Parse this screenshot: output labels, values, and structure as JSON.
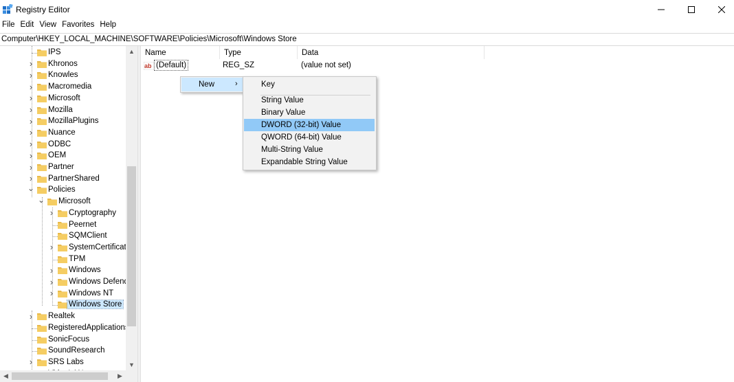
{
  "window": {
    "title": "Registry Editor"
  },
  "menu": [
    "File",
    "Edit",
    "View",
    "Favorites",
    "Help"
  ],
  "address": "Computer\\HKEY_LOCAL_MACHINE\\SOFTWARE\\Policies\\Microsoft\\Windows Store",
  "tree": {
    "top_level": [
      {
        "label": "IPS",
        "expandable": false
      },
      {
        "label": "Khronos",
        "expandable": true
      },
      {
        "label": "Knowles",
        "expandable": true
      },
      {
        "label": "Macromedia",
        "expandable": true
      },
      {
        "label": "Microsoft",
        "expandable": true
      },
      {
        "label": "Mozilla",
        "expandable": true
      },
      {
        "label": "MozillaPlugins",
        "expandable": true
      },
      {
        "label": "Nuance",
        "expandable": true
      },
      {
        "label": "ODBC",
        "expandable": true
      },
      {
        "label": "OEM",
        "expandable": true
      },
      {
        "label": "Partner",
        "expandable": true
      },
      {
        "label": "PartnerShared",
        "expandable": true
      },
      {
        "label": "Policies",
        "expandable": true,
        "expanded": true
      }
    ],
    "policies_child": {
      "label": "Microsoft",
      "expanded": true
    },
    "microsoft_children": [
      {
        "label": "Cryptography",
        "expandable": true
      },
      {
        "label": "Peernet",
        "expandable": false
      },
      {
        "label": "SQMClient",
        "expandable": false
      },
      {
        "label": "SystemCertificates",
        "expandable": true
      },
      {
        "label": "TPM",
        "expandable": false
      },
      {
        "label": "Windows",
        "expandable": true
      },
      {
        "label": "Windows Defender",
        "expandable": true
      },
      {
        "label": "Windows NT",
        "expandable": true
      },
      {
        "label": "Windows Store",
        "expandable": false,
        "selected": true
      }
    ],
    "after": [
      {
        "label": "Realtek",
        "expandable": true
      },
      {
        "label": "RegisteredApplications",
        "expandable": false
      },
      {
        "label": "SonicFocus",
        "expandable": false
      },
      {
        "label": "SoundResearch",
        "expandable": false
      },
      {
        "label": "SRS Labs",
        "expandable": true
      },
      {
        "label": "VideoLAN",
        "expandable": true
      }
    ]
  },
  "list": {
    "columns": {
      "name": "Name",
      "type": "Type",
      "data": "Data"
    },
    "rows": [
      {
        "name": "(Default)",
        "type": "REG_SZ",
        "data": "(value not set)"
      }
    ]
  },
  "context_menu": {
    "new_label": "New",
    "submenu": {
      "key": "Key",
      "items": [
        "String Value",
        "Binary Value",
        "DWORD (32-bit) Value",
        "QWORD (64-bit) Value",
        "Multi-String Value",
        "Expandable String Value"
      ],
      "highlighted": "DWORD (32-bit) Value"
    }
  },
  "icons": {
    "app": "registry-editor-icon",
    "folder": "folder-icon",
    "string_value": "ab-string-value-icon"
  },
  "colors": {
    "folder": "#e8b94a",
    "selection": "#cce8ff",
    "menu_highlight": "#91c9f7"
  }
}
